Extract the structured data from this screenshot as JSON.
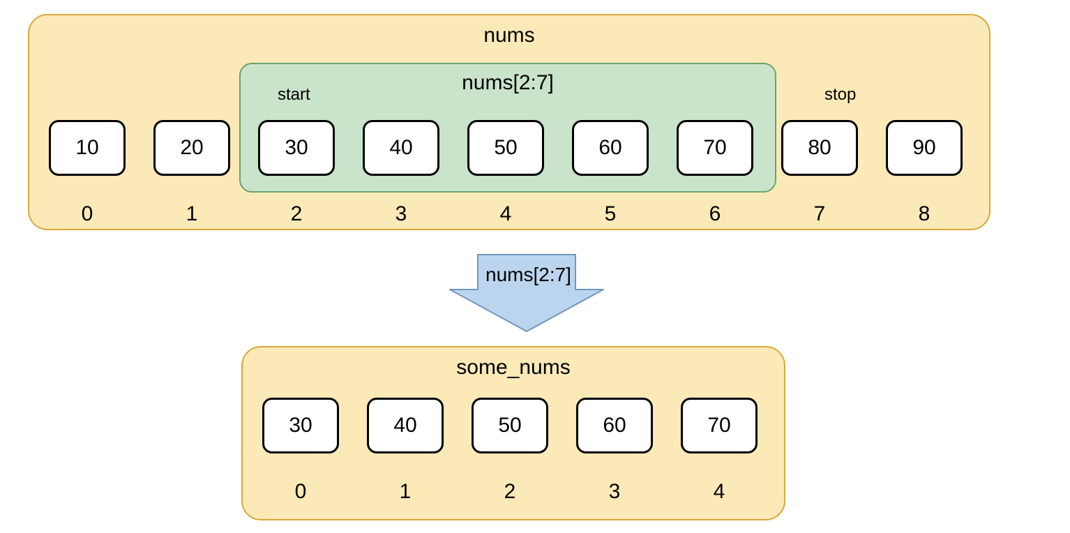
{
  "top_list": {
    "title": "nums",
    "cells": [
      "10",
      "20",
      "30",
      "40",
      "50",
      "60",
      "70",
      "80",
      "90"
    ],
    "indices": [
      "0",
      "1",
      "2",
      "3",
      "4",
      "5",
      "6",
      "7",
      "8"
    ],
    "slice_label": "nums[2:7]",
    "start_label": "start",
    "stop_label": "stop"
  },
  "arrow": {
    "label": "nums[2:7]"
  },
  "bottom_list": {
    "title": "some_nums",
    "cells": [
      "30",
      "40",
      "50",
      "60",
      "70"
    ],
    "indices": [
      "0",
      "1",
      "2",
      "3",
      "4"
    ]
  }
}
